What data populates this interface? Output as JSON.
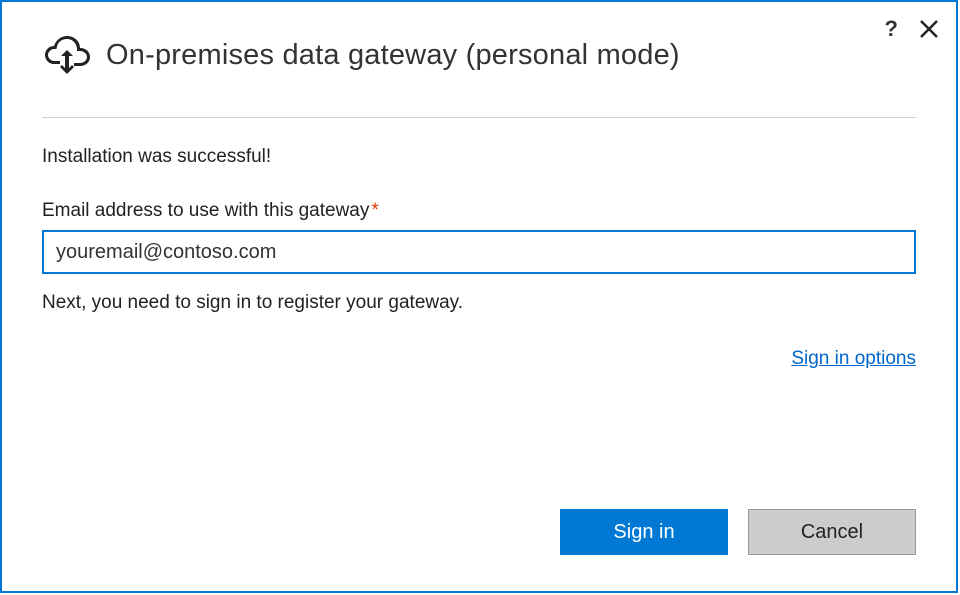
{
  "header": {
    "title": "On-premises data gateway (personal mode)"
  },
  "main": {
    "success_message": "Installation was successful!",
    "email_label": "Email address to use with this gateway",
    "email_value": "youremail@contoso.com",
    "next_step": "Next, you need to sign in to register your gateway.",
    "sign_in_options_label": "Sign in options"
  },
  "footer": {
    "primary_label": "Sign in",
    "secondary_label": "Cancel"
  },
  "icons": {
    "help": "?",
    "required": "*"
  }
}
